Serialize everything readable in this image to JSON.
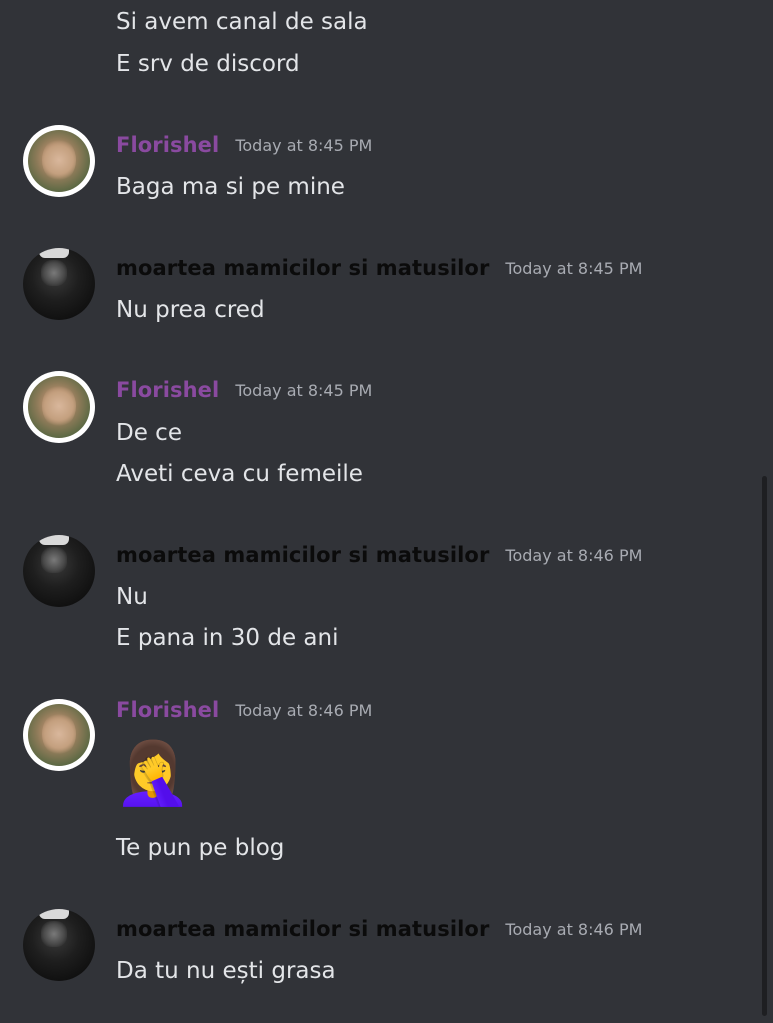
{
  "messages": [
    {
      "continued": true,
      "lines": [
        "Si avem canal de sala",
        "E srv de discord"
      ]
    },
    {
      "author": "Florishel",
      "time": "Today at 8:45 PM",
      "lines": [
        "Baga ma si pe mine"
      ]
    },
    {
      "author": "moartea mamicilor si matusilor",
      "time": "Today at 8:45 PM",
      "lines": [
        "Nu prea cred"
      ]
    },
    {
      "author": "Florishel",
      "time": "Today at 8:45 PM",
      "lines": [
        "De ce",
        "Aveti ceva cu femeile"
      ]
    },
    {
      "author": "moartea mamicilor si matusilor",
      "time": "Today at 8:46 PM",
      "lines": [
        "Nu",
        "E pana in 30 de ani"
      ]
    },
    {
      "author": "Florishel",
      "time": "Today at 8:46 PM",
      "emoji": "🤦‍♀️",
      "lines": [
        "Te pun pe blog"
      ]
    },
    {
      "author": "moartea mamicilor si matusilor",
      "time": "Today at 8:46 PM",
      "lines": [
        "Da tu nu ești grasa"
      ]
    }
  ],
  "colors": {
    "background": "#313338",
    "florishel_name": "#8a4aa0",
    "moartea_name": "#0b0b0b",
    "text": "#e3e5e8",
    "timestamp": "#a8abb2"
  }
}
